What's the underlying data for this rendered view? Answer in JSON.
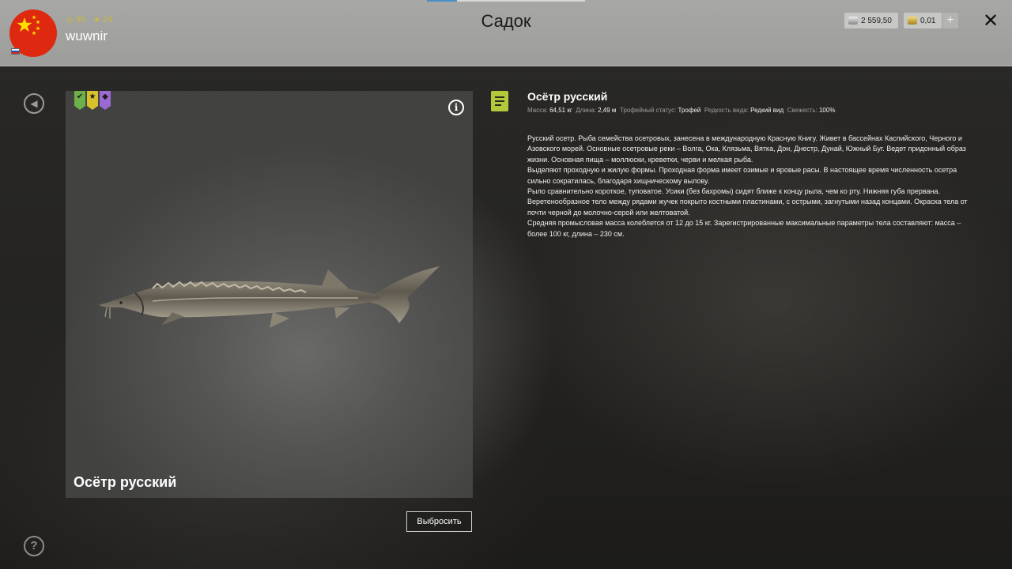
{
  "header": {
    "title": "Садок",
    "username": "wuwnir",
    "stat_level": "35",
    "stat_stars": "24",
    "money_silver": "2 559,50",
    "money_gold": "0,01",
    "plus_label": "+",
    "close_label": "✕"
  },
  "fish": {
    "name": "Осётр русский",
    "ribbons": [
      "green-check",
      "yellow-star",
      "purple-diamond"
    ],
    "properties": [
      {
        "label": "Масса:",
        "value": "64,51 кг"
      },
      {
        "label": "Длина:",
        "value": "2,49 м"
      },
      {
        "label": "Трофейный статус:",
        "value": "Трофей"
      },
      {
        "label": "Редкость вида:",
        "value": "Редкий вид"
      },
      {
        "label": "Свежесть:",
        "value": "100%"
      }
    ],
    "description": [
      "Русский осетр. Рыба семейства осетровых, занесена в международную Красную Книгу. Живет в бассейнах Каспийского, Черного и Азовского морей. Основные осетровые реки – Волга, Ока, Клязьма, Вятка, Дон, Днестр, Дунай, Южный Буг. Ведет придонный образ жизни. Основная пища – моллюски, креветки, черви и мелкая рыба.",
      " Выделяют проходную и жилую формы. Проходная форма имеет озимые и яровые расы. В настоящее время численность осетра сильно сократилась, благодаря хищническому вылову.",
      "Рыло сравнительно короткое, туповатое. Усики (без бахромы) сидят ближе к концу рыла, чем ко рту. Нижняя губа прервана. Веретенообразное тело между рядами жучек покрыто костными пластинами, с острыми, загнутыми назад концами. Окраска тела от почти черной до молочно-серой или желтоватой.",
      "Средняя промысловая масса колеблется от 12 до 15 кг. Зарегистрированные максимальные параметры тела составляют: масса – более 100 кг, длина – 230 см."
    ]
  },
  "actions": {
    "release_label": "Выбросить"
  },
  "icons": {
    "back": "back-arrow-icon",
    "help": "help-icon",
    "info": "info-icon",
    "note": "note-icon"
  }
}
